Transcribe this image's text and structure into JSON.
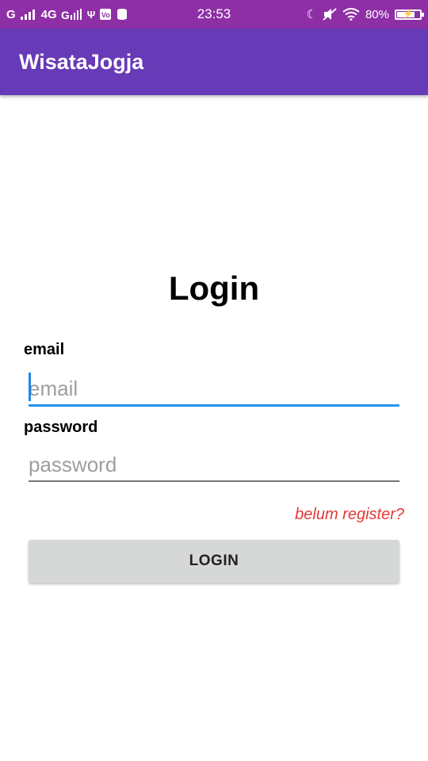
{
  "status_bar": {
    "signal_1": "G",
    "network_2": "4G",
    "time": "23:53",
    "battery_percent": "80%",
    "battery_level": 80
  },
  "app_bar": {
    "title": "WisataJogja"
  },
  "form": {
    "heading": "Login",
    "email_label": "email",
    "email_placeholder": "email",
    "password_label": "password",
    "password_placeholder": "password",
    "register_link": "belum register?",
    "login_button": "LOGIN"
  },
  "colors": {
    "status_bar": "#8e2fa6",
    "app_bar": "#673ab7",
    "focus_underline": "#2196f3",
    "link": "#e53935",
    "button": "#d6d7d7"
  }
}
